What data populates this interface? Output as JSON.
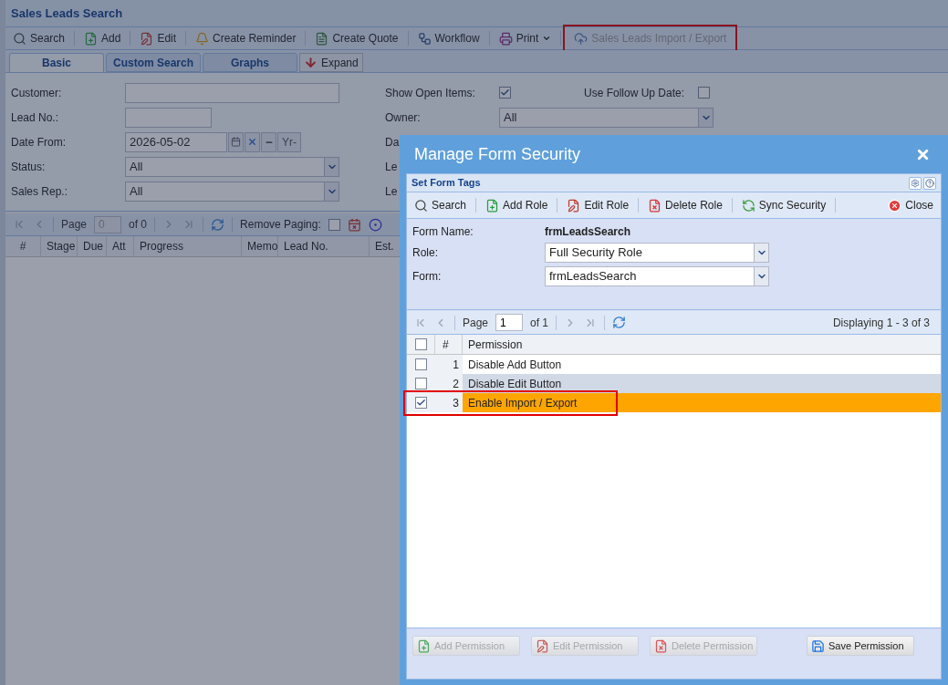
{
  "page": {
    "title": "Sales Leads Search",
    "toolbar": [
      {
        "label": "Search",
        "kind": "search",
        "disabled": false,
        "highlighted": false
      },
      {
        "label": "Add",
        "kind": "add",
        "disabled": false,
        "highlighted": false
      },
      {
        "label": "Edit",
        "kind": "edit",
        "disabled": false,
        "highlighted": false
      },
      {
        "label": "Create Reminder",
        "kind": "reminder",
        "disabled": false,
        "highlighted": false
      },
      {
        "label": "Create Quote",
        "kind": "quote",
        "disabled": false,
        "highlighted": false
      },
      {
        "label": "Workflow",
        "kind": "workflow",
        "disabled": false,
        "highlighted": false
      },
      {
        "label": "Print",
        "kind": "print",
        "disabled": false,
        "highlighted": false
      },
      {
        "label": "Sales Leads Import / Export",
        "kind": "import",
        "disabled": true,
        "highlighted": true
      }
    ],
    "tabs": [
      {
        "label": "Basic",
        "selected": true
      },
      {
        "label": "Custom Search",
        "selected": false
      },
      {
        "label": "Graphs",
        "selected": false
      }
    ],
    "expand_button": "Expand",
    "filters_left": [
      {
        "label": "Customer:",
        "kind": "text"
      },
      {
        "label": "Lead No.:",
        "kind": "short"
      },
      {
        "label": "Date From:",
        "kind": "date",
        "value": "2026-05-02",
        "year_button": "Yr-"
      },
      {
        "label": "Status:",
        "kind": "select",
        "value": "All"
      },
      {
        "label": "Sales Rep.:",
        "kind": "select",
        "value": "All"
      }
    ],
    "filters_right": [
      {
        "label": "Show Open Items:",
        "kind": "check",
        "checked": true,
        "extra_label": "Use Follow Up Date:",
        "extra_checked": false
      },
      {
        "label": "Owner:",
        "kind": "select",
        "value": "All"
      },
      {
        "label": "Da",
        "kind": "label"
      },
      {
        "label": "Le",
        "kind": "label"
      },
      {
        "label": "Le",
        "kind": "label"
      }
    ],
    "grid": {
      "page_label": "Page",
      "page": "0",
      "of": "of 0",
      "remove_paging": "Remove Paging:",
      "remove_paging_checked": false,
      "columns": [
        "#",
        "Stage",
        "Due",
        "Att",
        "Progress",
        "Memo",
        "Lead No.",
        "Est."
      ]
    }
  },
  "dialog": {
    "title": "Manage Form Security",
    "panel_title": "Set Form Tags",
    "toolbar": [
      {
        "label": "Search",
        "kind": "search"
      },
      {
        "label": "Add Role",
        "kind": "add"
      },
      {
        "label": "Edit Role",
        "kind": "edit"
      },
      {
        "label": "Delete Role",
        "kind": "delete"
      },
      {
        "label": "Sync Security",
        "kind": "sync"
      }
    ],
    "close_button": "Close",
    "form_name_label": "Form Name:",
    "form_name": "frmLeadsSearch",
    "role_label": "Role:",
    "role": "Full Security Role",
    "form_label": "Form:",
    "form": "frmLeadsSearch",
    "pager": {
      "page_label": "Page",
      "page": "1",
      "of": "of 1",
      "displaying": "Displaying 1 - 3 of 3"
    },
    "columns": [
      "#",
      "Permission"
    ],
    "header_checked": false,
    "rows": [
      {
        "number": "1",
        "permission": "Disable Add Button",
        "checked": false,
        "selected": false,
        "highlighted": false
      },
      {
        "number": "2",
        "permission": "Disable Edit Button",
        "checked": false,
        "selected": false,
        "highlighted": false
      },
      {
        "number": "3",
        "permission": "Enable Import / Export",
        "checked": true,
        "selected": true,
        "highlighted": true
      }
    ],
    "buttons": [
      {
        "label": "Add Permission",
        "kind": "add",
        "disabled": true
      },
      {
        "label": "Edit Permission",
        "kind": "edit",
        "disabled": true
      },
      {
        "label": "Delete Permission",
        "kind": "delete",
        "disabled": true
      },
      {
        "label": "Save Permission",
        "kind": "save",
        "disabled": false
      }
    ]
  }
}
